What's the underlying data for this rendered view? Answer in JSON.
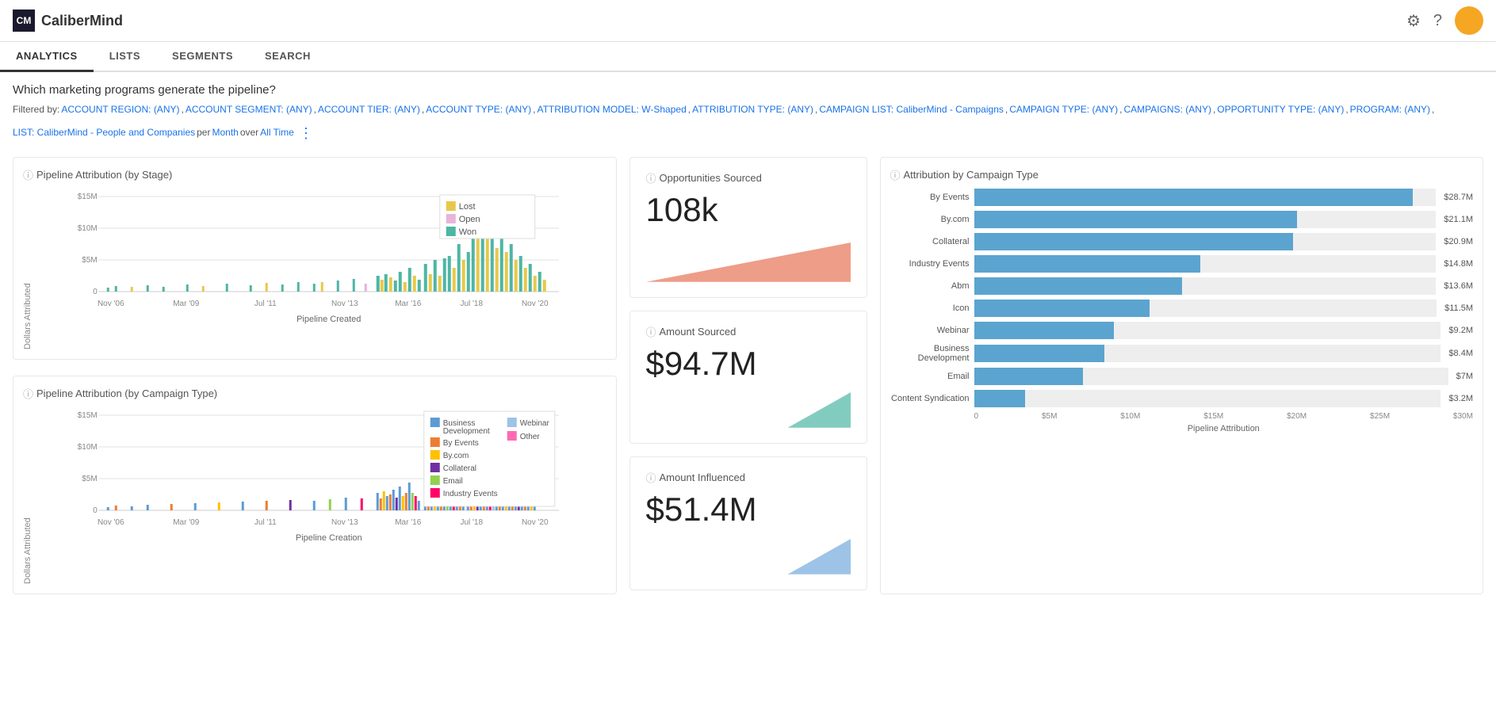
{
  "header": {
    "logo_text": "CaliberMind",
    "nav_items": [
      "ANALYTICS",
      "LISTS",
      "SEGMENTS",
      "SEARCH"
    ],
    "active_nav": "ANALYTICS"
  },
  "page": {
    "question": "Which marketing programs generate the pipeline?",
    "filter_prefix": "Filtered by:",
    "filters": [
      "ACCOUNT REGION: (ANY)",
      "ACCOUNT SEGMENT: (ANY)",
      "ACCOUNT TIER: (ANY)",
      "ACCOUNT TYPE: (ANY)",
      "ATTRIBUTION MODEL: W-Shaped",
      "ATTRIBUTION TYPE: (ANY)",
      "CAMPAIGN LIST: CaliberMind - Campaigns",
      "CAMPAIGN TYPE: (ANY)",
      "CAMPAIGNS: (ANY)",
      "OPPORTUNITY TYPE: (ANY)",
      "PROGRAM: (ANY)",
      "LIST: CaliberMind - People and Companies"
    ],
    "per_label": "per",
    "per_value": "Month",
    "over_label": "over",
    "over_value": "All Time"
  },
  "chart1": {
    "title": "Pipeline Attribution (by Stage)",
    "y_label": "Dollars Attributed",
    "x_label": "Pipeline Created",
    "y_ticks": [
      "$15M",
      "$10M",
      "$5M",
      "0"
    ],
    "x_ticks": [
      "Nov '06",
      "Mar '09",
      "Jul '11",
      "Nov '13",
      "Mar '16",
      "Jul '18",
      "Nov '20"
    ],
    "legend": [
      {
        "label": "Lost",
        "color": "#e8c84a"
      },
      {
        "label": "Open",
        "color": "#e8b4d8"
      },
      {
        "label": "Won",
        "color": "#4db6a4"
      }
    ]
  },
  "chart2": {
    "title": "Pipeline Attribution (by Campaign Type)",
    "y_label": "Dollars Attributed",
    "x_label": "Pipeline Creation",
    "y_ticks": [
      "$15M",
      "$10M",
      "$5M",
      "0"
    ],
    "x_ticks": [
      "Nov '06",
      "Mar '09",
      "Jul '11",
      "Nov '13",
      "Mar '16",
      "Jul '18",
      "Nov '20"
    ],
    "legend": [
      {
        "label": "Business Development",
        "color": "#5b9bd5"
      },
      {
        "label": "By Events",
        "color": "#ed7d31"
      },
      {
        "label": "By.com",
        "color": "#ffc000"
      },
      {
        "label": "Collateral",
        "color": "#7030a0"
      },
      {
        "label": "Email",
        "color": "#92d050"
      },
      {
        "label": "Industry Events",
        "color": "#ff0066"
      },
      {
        "label": "Webinar",
        "color": "#9dc3e6"
      },
      {
        "label": "Other",
        "color": "#ff69b4"
      }
    ]
  },
  "metrics": {
    "opportunities": {
      "label": "Opportunities Sourced",
      "value": "108k"
    },
    "amount_sourced": {
      "label": "Amount Sourced",
      "value": "$94.7M"
    },
    "amount_influenced": {
      "label": "Amount Influenced",
      "value": "$51.4M"
    }
  },
  "attribution_chart": {
    "title": "Attribution by Campaign Type",
    "bars": [
      {
        "label": "By Events",
        "value": "$28.7M",
        "pct": 95
      },
      {
        "label": "By.com",
        "value": "$21.1M",
        "pct": 70
      },
      {
        "label": "Collateral",
        "value": "$20.9M",
        "pct": 69
      },
      {
        "label": "Industry Events",
        "value": "$14.8M",
        "pct": 49
      },
      {
        "label": "Abm",
        "value": "$13.6M",
        "pct": 45
      },
      {
        "label": "Icon",
        "value": "$11.5M",
        "pct": 38
      },
      {
        "label": "Webinar",
        "value": "$9.2M",
        "pct": 30
      },
      {
        "label": "Business Development",
        "value": "$8.4M",
        "pct": 28
      },
      {
        "label": "Email",
        "value": "$7M",
        "pct": 23
      },
      {
        "label": "Content Syndication",
        "value": "$3.2M",
        "pct": 11
      }
    ],
    "x_ticks": [
      "0",
      "$5M",
      "$10M",
      "$15M",
      "$20M",
      "$25M",
      "$30M"
    ],
    "x_title": "Pipeline Attribution"
  }
}
